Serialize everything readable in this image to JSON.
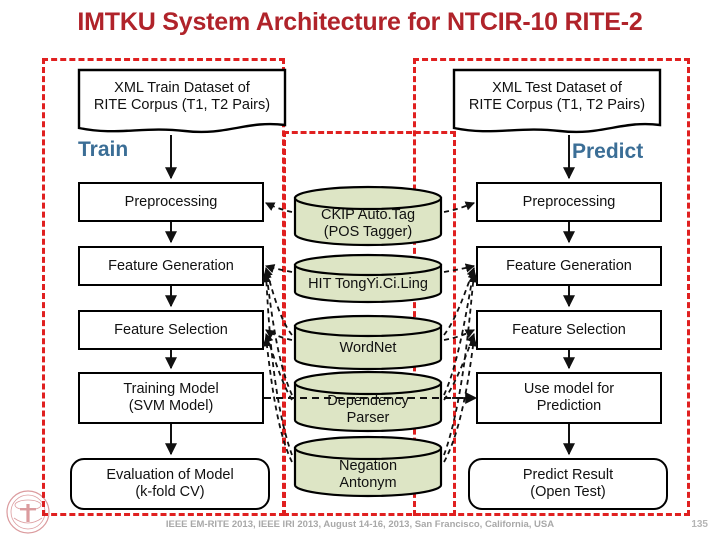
{
  "title": "IMTKU System Architecture for NTCIR-10 RITE-2",
  "colors": {
    "title_red": "#B0232A",
    "zone_red": "#E02020",
    "stage_label_blue": "#3B6E96",
    "cylinder_fill": "#DDE5C5",
    "node_border": "#000000",
    "footer_gray": "#A8A8A8"
  },
  "zones": [
    {
      "name": "train-zone"
    },
    {
      "name": "resources-zone"
    },
    {
      "name": "predict-zone"
    }
  ],
  "stage_labels": {
    "train": "Train",
    "predict": "Predict"
  },
  "train_flow": {
    "dataset": "XML Train Dataset of\nRITE Corpus (T1, T2 Pairs)",
    "dataset_line1": "XML Train Dataset of",
    "dataset_line2": "RITE Corpus (T1, T2 Pairs)",
    "steps": [
      {
        "label": "Preprocessing",
        "shape": "rect"
      },
      {
        "label": "Feature Generation",
        "shape": "rect"
      },
      {
        "label": "Feature Selection",
        "shape": "rect"
      },
      {
        "label": "Training Model\n(SVM Model)",
        "line1": "Training Model",
        "line2": "(SVM Model)",
        "shape": "rect"
      },
      {
        "label": "Evaluation of Model\n(k-fold CV)",
        "line1": "Evaluation of Model",
        "line2": "(k-fold CV)",
        "shape": "rounded"
      }
    ]
  },
  "predict_flow": {
    "dataset_line1": "XML Test Dataset of",
    "dataset_line2": "RITE Corpus (T1, T2 Pairs)",
    "steps": [
      {
        "label": "Preprocessing",
        "shape": "rect"
      },
      {
        "label": "Feature Generation",
        "shape": "rect"
      },
      {
        "label": "Feature Selection",
        "shape": "rect"
      },
      {
        "label": "Use model for\nPrediction",
        "line1": "Use model for",
        "line2": "Prediction",
        "shape": "rect"
      },
      {
        "label": "Predict Result\n(Open Test)",
        "line1": "Predict Result",
        "line2": "(Open Test)",
        "shape": "rounded"
      }
    ]
  },
  "resources": [
    {
      "line1": "CKIP Auto.Tag",
      "line2": "(POS Tagger)"
    },
    {
      "line1": "HIT TongYi.Ci.Ling",
      "line2": ""
    },
    {
      "line1": "WordNet",
      "line2": ""
    },
    {
      "line1": "Dependency",
      "line2": "Parser"
    },
    {
      "line1": "Negation",
      "line2": "Antonym"
    }
  ],
  "footer": {
    "text": "IEEE EM-RITE 2013, IEEE IRI 2013, August 14-16, 2013, San Francisco, California, USA",
    "page_number": "135"
  }
}
